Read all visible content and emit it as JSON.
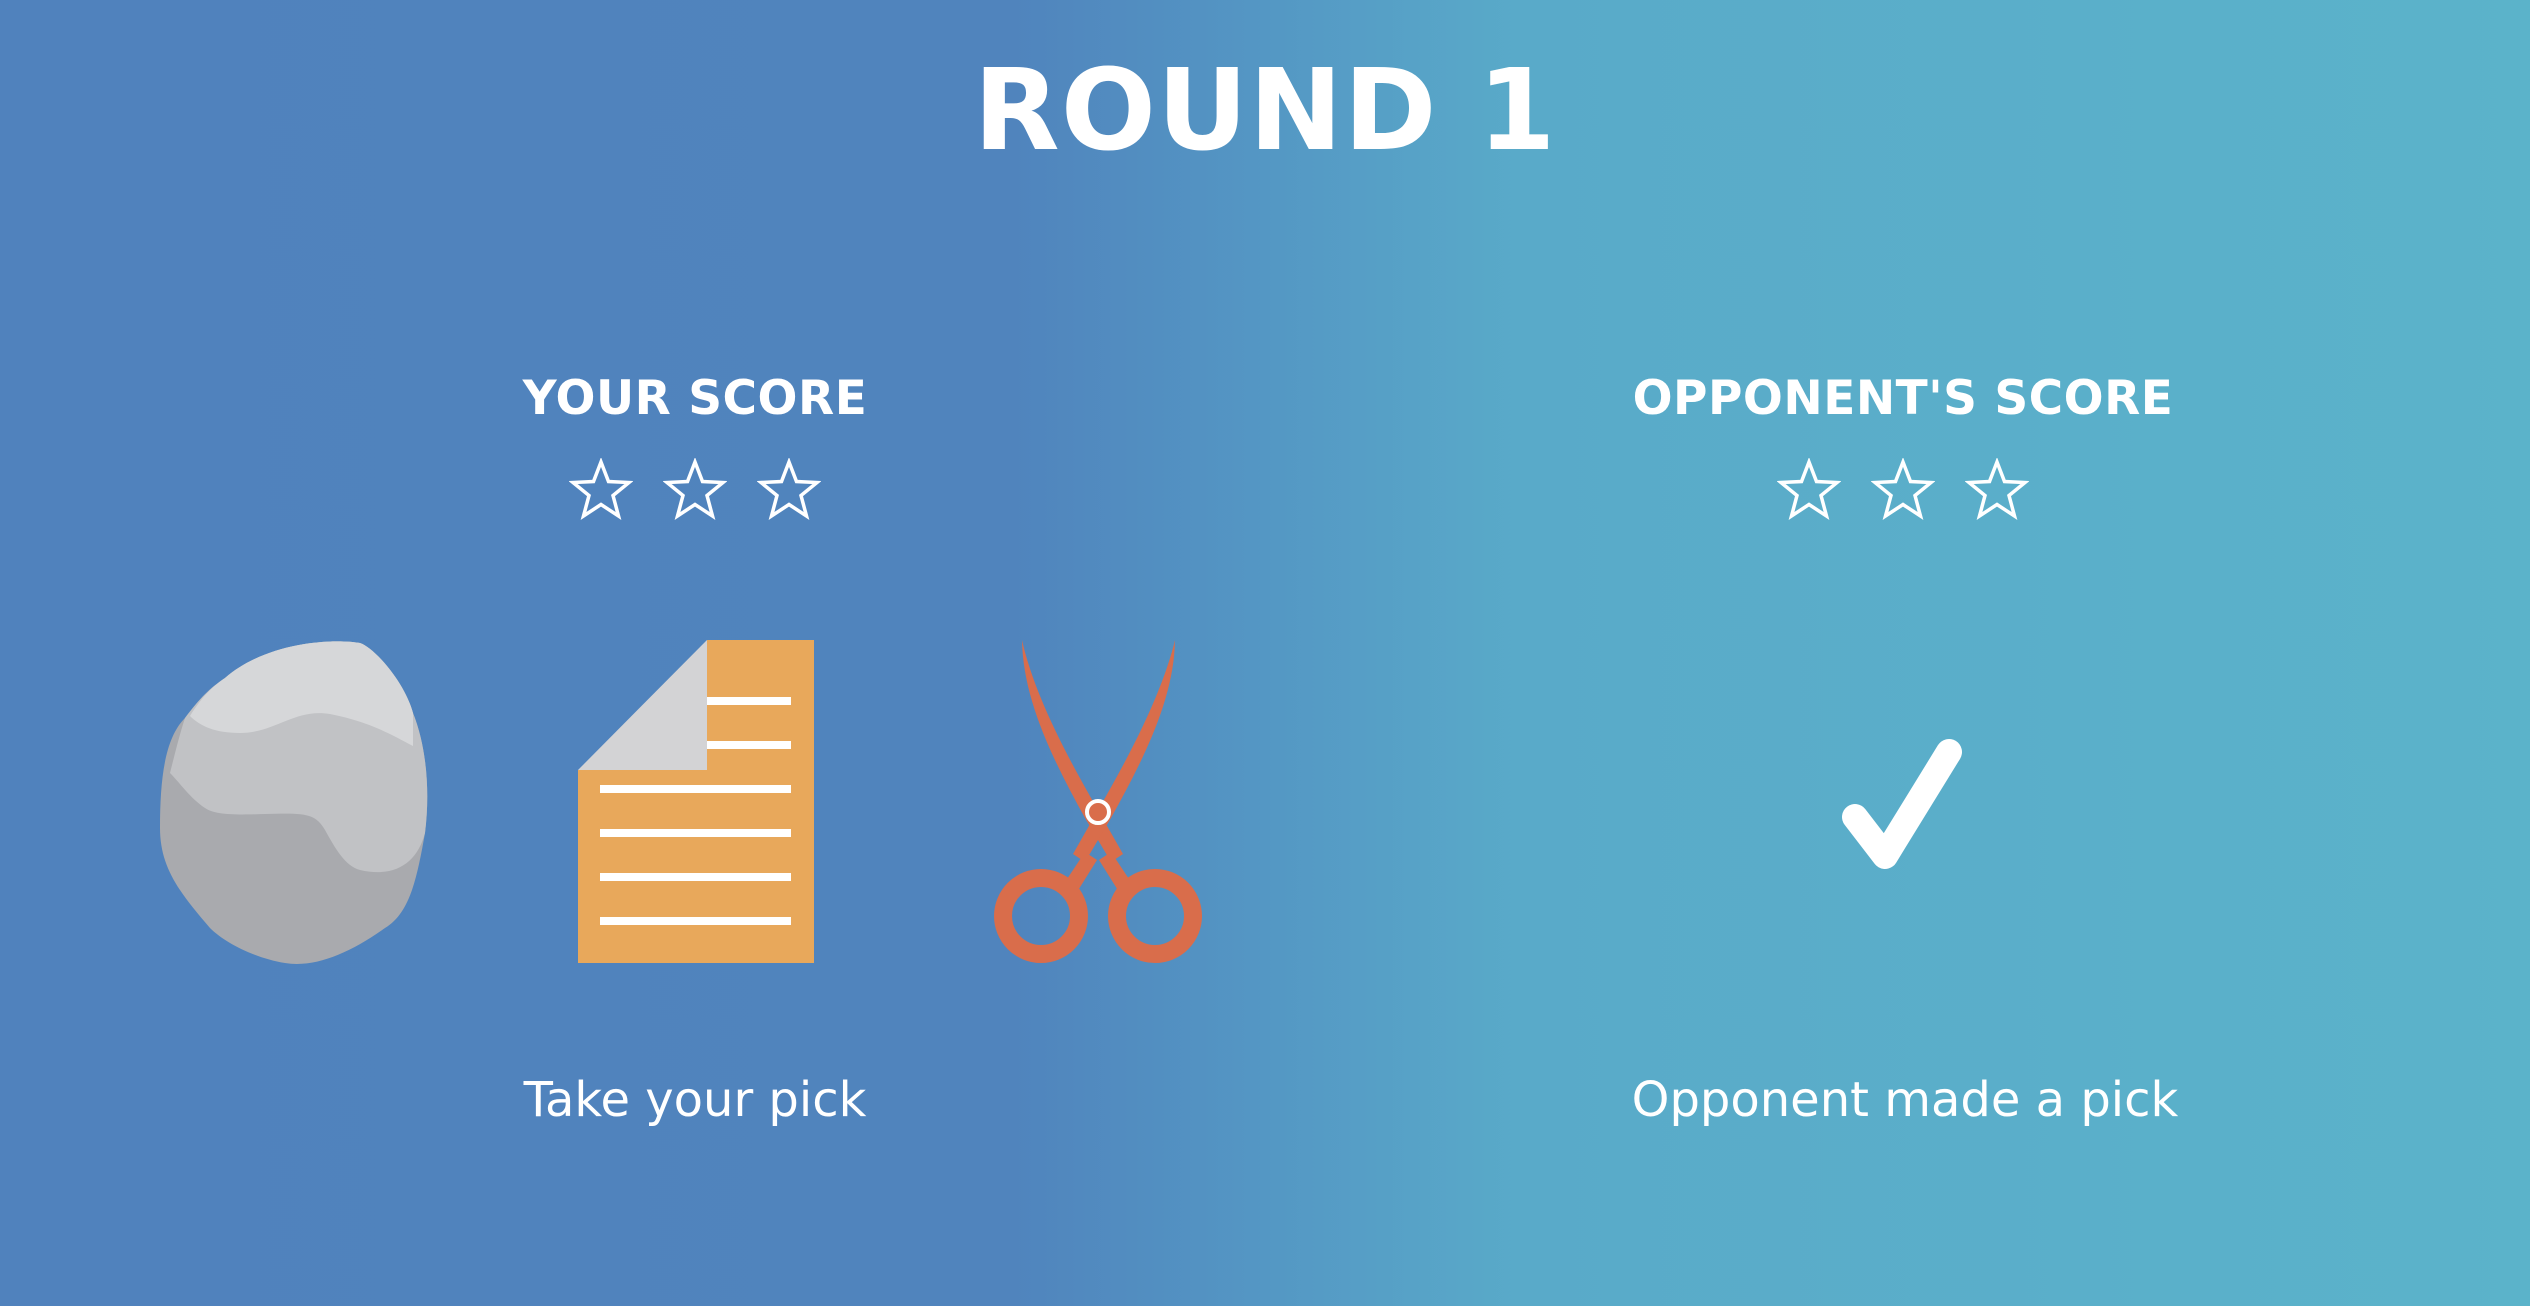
{
  "round": {
    "title": "ROUND 1"
  },
  "player": {
    "score_label": "YOUR SCORE",
    "stars_filled": 0,
    "stars_total": 3,
    "prompt": "Take your pick",
    "choices": [
      {
        "name": "rock",
        "icon": "rock-icon"
      },
      {
        "name": "paper",
        "icon": "paper-icon"
      },
      {
        "name": "scissors",
        "icon": "scissors-icon"
      }
    ]
  },
  "opponent": {
    "score_label": "OPPONENT'S SCORE",
    "stars_filled": 0,
    "stars_total": 3,
    "status": "Opponent made a pick",
    "status_icon": "checkmark-icon"
  },
  "colors": {
    "background_left": "#5082bd",
    "background_right": "#5bb3ca",
    "text": "#ffffff",
    "paper": "#e8a85b",
    "paper_fold": "#d3d3d5",
    "scissors": "#d96d4b",
    "rock_light": "#d6d7d9",
    "rock_mid": "#c1c2c5",
    "rock_dark": "#a9aaae"
  }
}
